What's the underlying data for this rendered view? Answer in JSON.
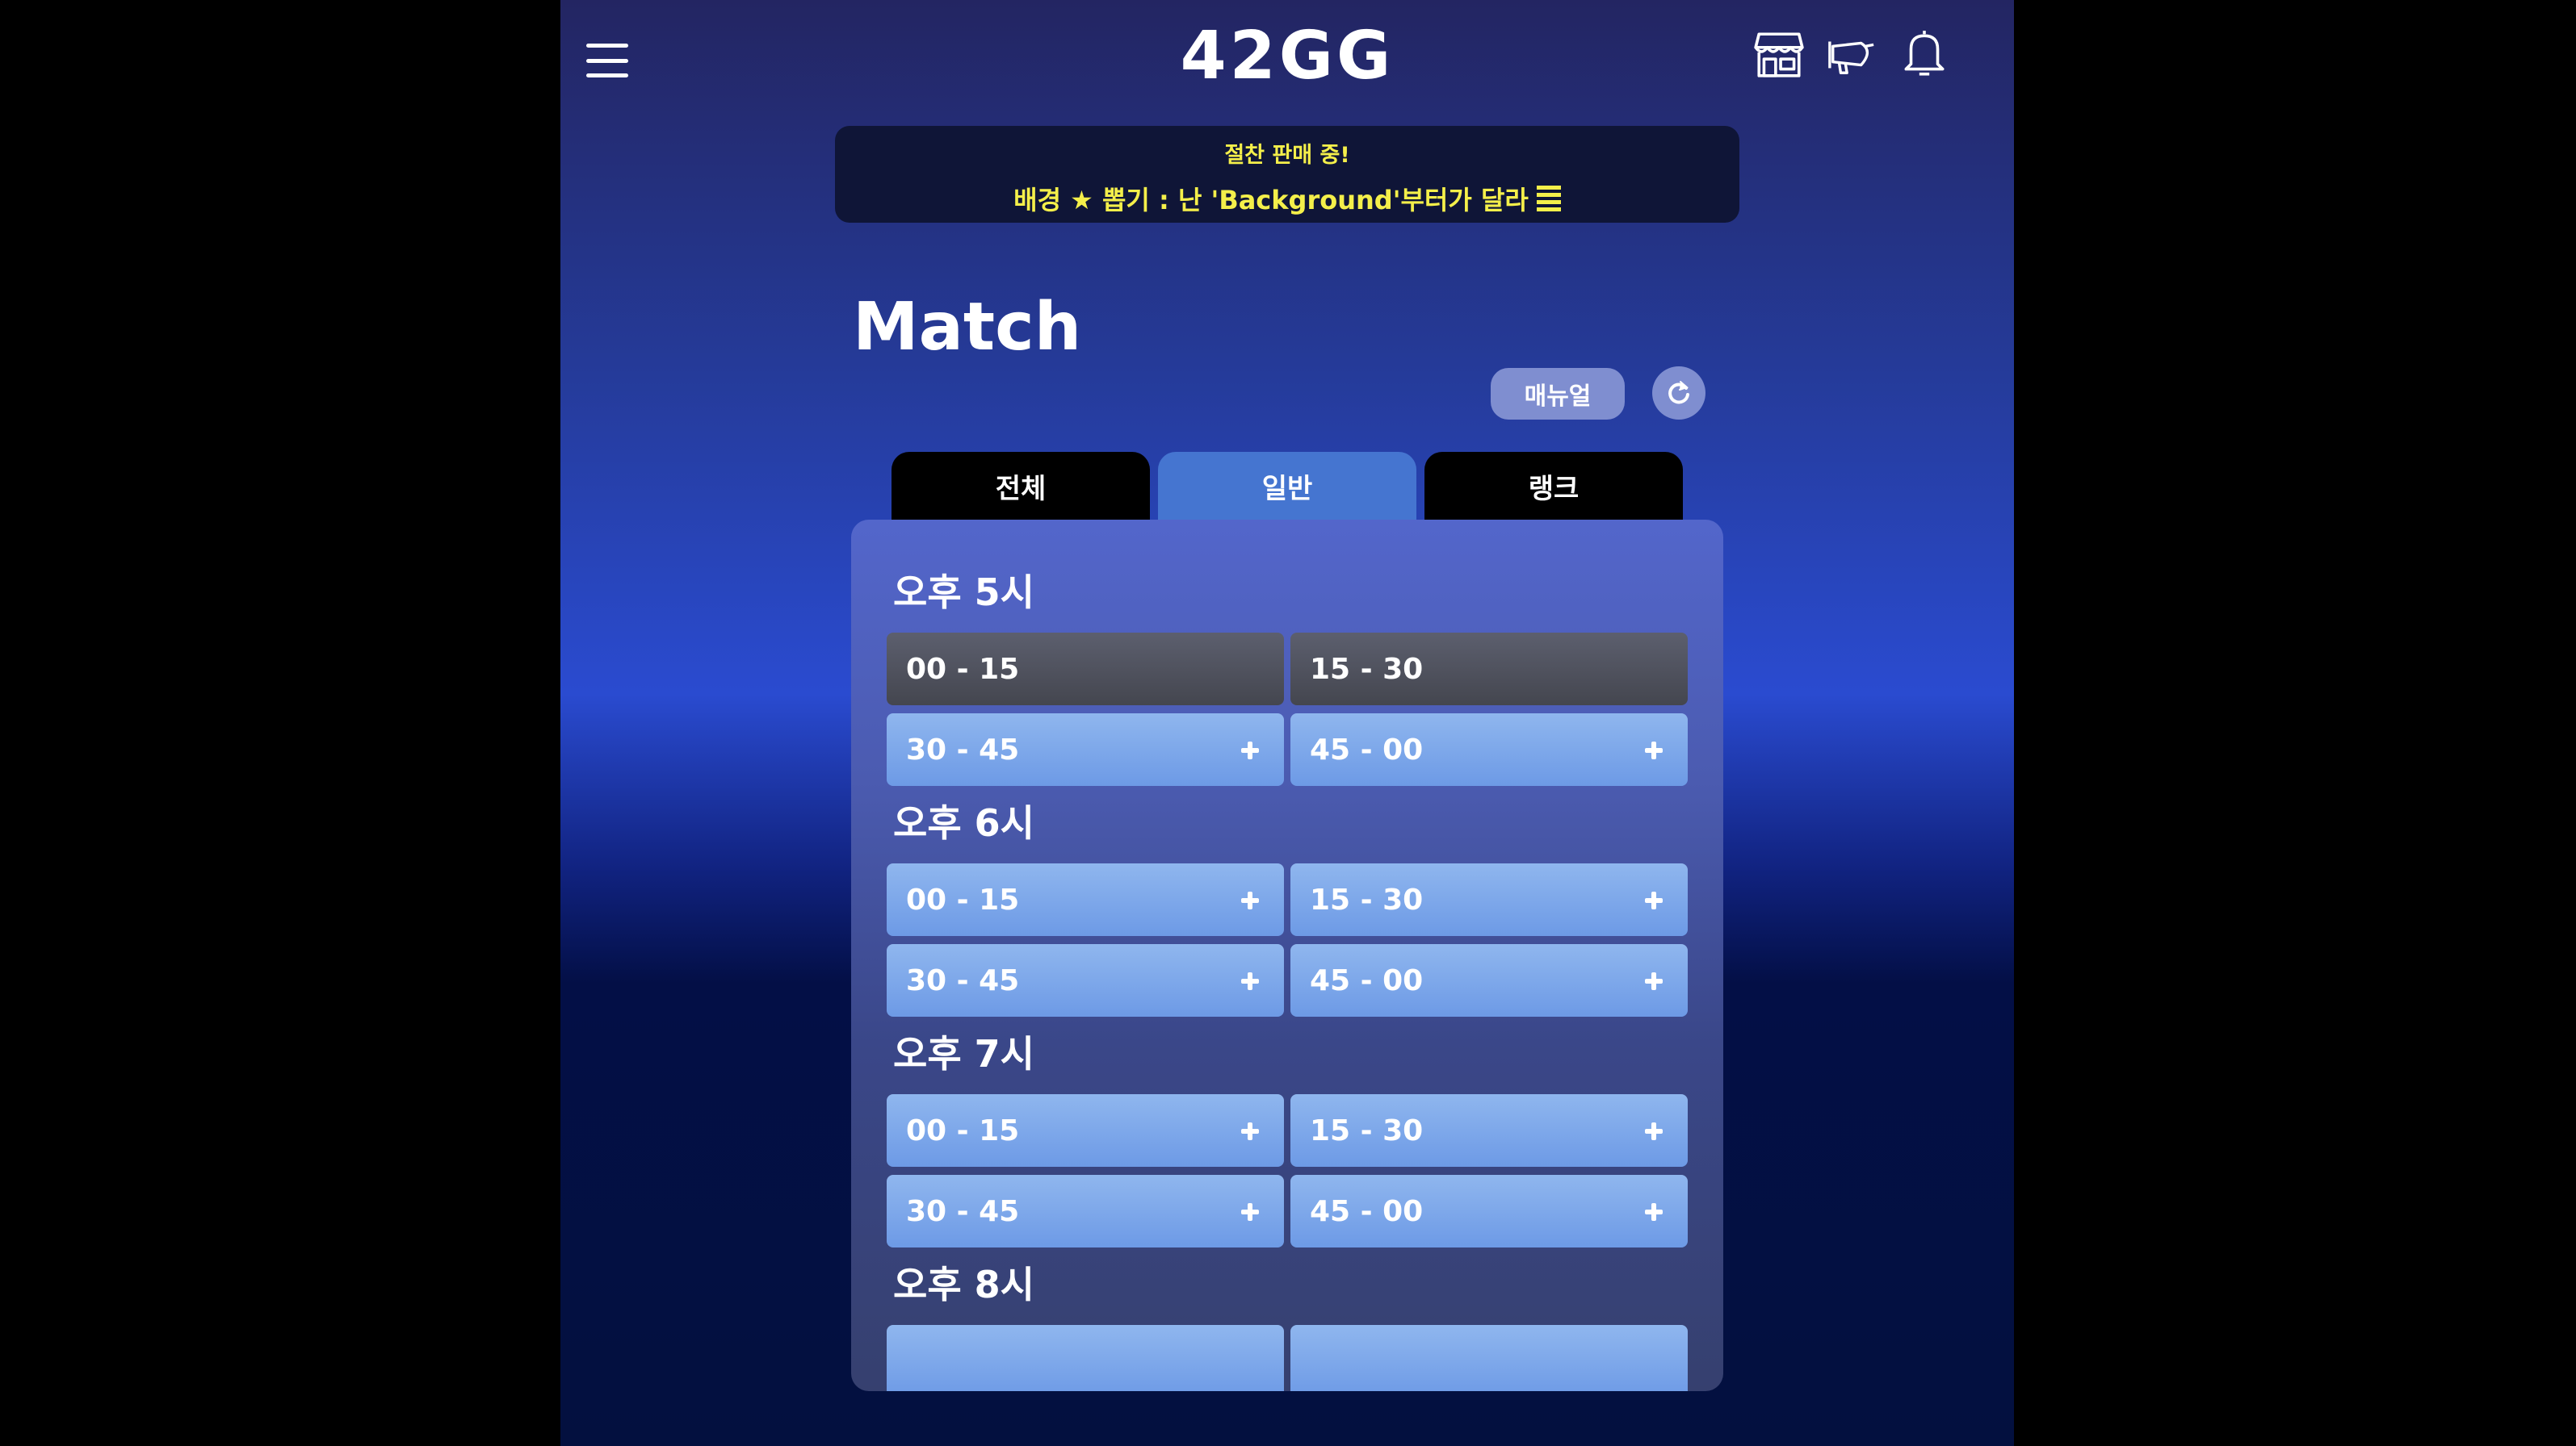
{
  "header": {
    "logo": "42GG",
    "icons": [
      "menu-icon",
      "store-icon",
      "megaphone-icon",
      "bell-icon"
    ]
  },
  "banner": {
    "line1": "절찬 판매 중!",
    "line2": "배경 ★ 뽑기 : 난 'Background'부터가 달라"
  },
  "page": {
    "title": "Match",
    "manual_label": "매뉴얼"
  },
  "tabs": [
    {
      "label": "전체",
      "active": false
    },
    {
      "label": "일반",
      "active": true
    },
    {
      "label": "랭크",
      "active": false
    }
  ],
  "hours": [
    {
      "label": "오후 5시",
      "slots": [
        {
          "time": "00 - 15",
          "open": false
        },
        {
          "time": "15 - 30",
          "open": false
        },
        {
          "time": "30 - 45",
          "open": true
        },
        {
          "time": "45 - 00",
          "open": true
        }
      ]
    },
    {
      "label": "오후 6시",
      "slots": [
        {
          "time": "00 - 15",
          "open": true
        },
        {
          "time": "15 - 30",
          "open": true
        },
        {
          "time": "30 - 45",
          "open": true
        },
        {
          "time": "45 - 00",
          "open": true
        }
      ]
    },
    {
      "label": "오후 7시",
      "slots": [
        {
          "time": "00 - 15",
          "open": true
        },
        {
          "time": "15 - 30",
          "open": true
        },
        {
          "time": "30 - 45",
          "open": true
        },
        {
          "time": "45 - 00",
          "open": true
        }
      ]
    },
    {
      "label": "오후 8시",
      "slots": [
        {
          "time": "",
          "open": true
        },
        {
          "time": "",
          "open": true
        }
      ]
    }
  ],
  "colors": {
    "accent": "#4575d0",
    "banner_text": "#f4ef4a",
    "slot_open": "#7fa7ea",
    "slot_closed": "#4f525d"
  }
}
